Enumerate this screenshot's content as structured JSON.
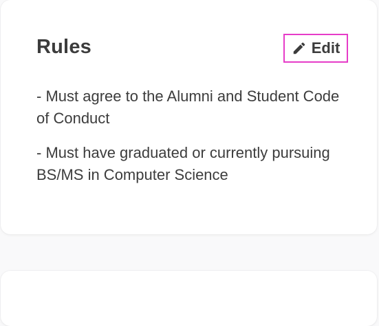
{
  "rules_card": {
    "title": "Rules",
    "edit_label": "Edit",
    "edit_icon": "pencil-icon",
    "highlight_color": "#e63cc8",
    "items": [
      "- Must agree to the Alumni and Student Code of Conduct",
      "- Must have graduated or currently pursuing BS/MS in Computer Science"
    ]
  }
}
